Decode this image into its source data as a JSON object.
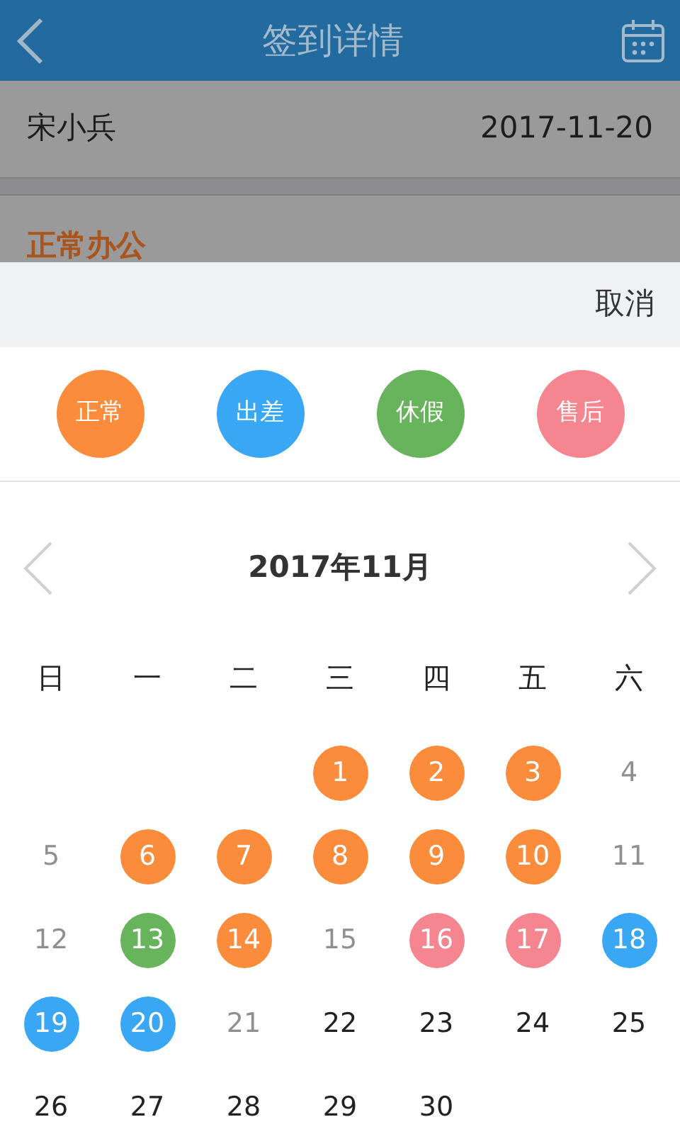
{
  "header": {
    "title": "签到详情"
  },
  "record": {
    "name": "宋小兵",
    "date": "2017-11-20",
    "status": "正常办公"
  },
  "sheet": {
    "cancel": "取消",
    "legend": [
      {
        "label": "正常",
        "color": "#fb8c3c"
      },
      {
        "label": "出差",
        "color": "#3aa7f4"
      },
      {
        "label": "休假",
        "color": "#68b45c"
      },
      {
        "label": "售后",
        "color": "#f5858e"
      }
    ],
    "calendar": {
      "month": "2017年11月",
      "weekdays": [
        "日",
        "一",
        "二",
        "三",
        "四",
        "五",
        "六"
      ],
      "weeks": [
        [
          {
            "kind": "blank"
          },
          {
            "kind": "blank"
          },
          {
            "kind": "blank"
          },
          {
            "day": "1",
            "kind": "marked",
            "color": "#fb8c3c"
          },
          {
            "day": "2",
            "kind": "marked",
            "color": "#fb8c3c"
          },
          {
            "day": "3",
            "kind": "marked",
            "color": "#fb8c3c"
          },
          {
            "day": "4",
            "kind": "past"
          }
        ],
        [
          {
            "day": "5",
            "kind": "past"
          },
          {
            "day": "6",
            "kind": "marked",
            "color": "#fb8c3c"
          },
          {
            "day": "7",
            "kind": "marked",
            "color": "#fb8c3c"
          },
          {
            "day": "8",
            "kind": "marked",
            "color": "#fb8c3c"
          },
          {
            "day": "9",
            "kind": "marked",
            "color": "#fb8c3c"
          },
          {
            "day": "10",
            "kind": "marked",
            "color": "#fb8c3c"
          },
          {
            "day": "11",
            "kind": "past"
          }
        ],
        [
          {
            "day": "12",
            "kind": "past"
          },
          {
            "day": "13",
            "kind": "marked",
            "color": "#68b45c"
          },
          {
            "day": "14",
            "kind": "marked",
            "color": "#fb8c3c"
          },
          {
            "day": "15",
            "kind": "past"
          },
          {
            "day": "16",
            "kind": "marked",
            "color": "#f5858e"
          },
          {
            "day": "17",
            "kind": "marked",
            "color": "#f5858e"
          },
          {
            "day": "18",
            "kind": "marked",
            "color": "#3aa7f4"
          }
        ],
        [
          {
            "day": "19",
            "kind": "marked",
            "color": "#3aa7f4"
          },
          {
            "day": "20",
            "kind": "marked",
            "color": "#3aa7f4"
          },
          {
            "day": "21",
            "kind": "past"
          },
          {
            "day": "22",
            "kind": "future"
          },
          {
            "day": "23",
            "kind": "future"
          },
          {
            "day": "24",
            "kind": "future"
          },
          {
            "day": "25",
            "kind": "future"
          }
        ],
        [
          {
            "day": "26",
            "kind": "future"
          },
          {
            "day": "27",
            "kind": "future"
          },
          {
            "day": "28",
            "kind": "future"
          },
          {
            "day": "29",
            "kind": "future"
          },
          {
            "day": "30",
            "kind": "future"
          }
        ]
      ]
    }
  }
}
